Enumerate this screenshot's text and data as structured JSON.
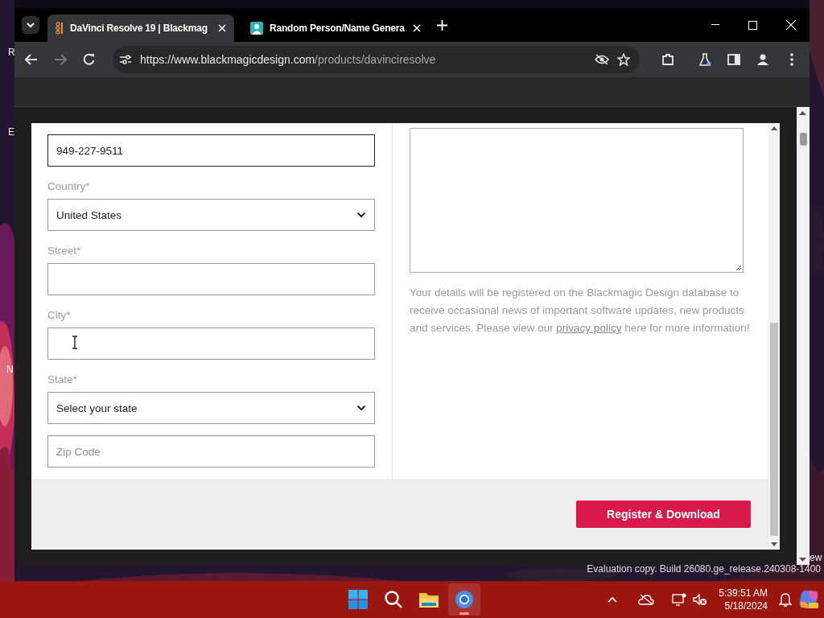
{
  "desktop": {
    "labels": [
      "R",
      "E",
      "N",
      "ew"
    ],
    "watermark": "Evaluation copy. Build 26080.ge_release.240308-1400"
  },
  "browser": {
    "tabs": [
      {
        "title": "DaVinci Resolve 19 | Blackmag",
        "kind": "resolve",
        "selected": true
      },
      {
        "title": "Random Person/Name Genera",
        "kind": "person",
        "selected": false
      }
    ],
    "url_host": "https://www.blackmagicdesign.com",
    "url_path": "/products/davinciresolve"
  },
  "form": {
    "fields": [
      {
        "kind": "text",
        "value": "949-227-9511",
        "focused": true
      },
      {
        "kind": "select",
        "label": "Country*",
        "value": "United States"
      },
      {
        "kind": "text",
        "label": "Street*",
        "focused": false
      },
      {
        "kind": "text",
        "label": "City*",
        "focused": false,
        "cursor": true
      },
      {
        "kind": "select",
        "label": "State*",
        "value": "Select your state"
      },
      {
        "kind": "text",
        "placeholder": "Zip Code",
        "focused": false
      }
    ],
    "notice": {
      "before": "Your details will be registered on the Blackmagic Design database to receive occasional news of important software updates, new products and services. Please view our",
      "link": "privacy policy",
      "after": "here for more information!"
    },
    "submit": "Register & Download"
  },
  "taskbar": {
    "apps": [
      {
        "kind": "windows",
        "selected": false
      },
      {
        "kind": "search",
        "selected": false
      },
      {
        "kind": "files",
        "selected": false
      },
      {
        "kind": "chrome",
        "selected": true
      }
    ],
    "time": "5:39:51 AM",
    "date": "5/18/2024"
  }
}
